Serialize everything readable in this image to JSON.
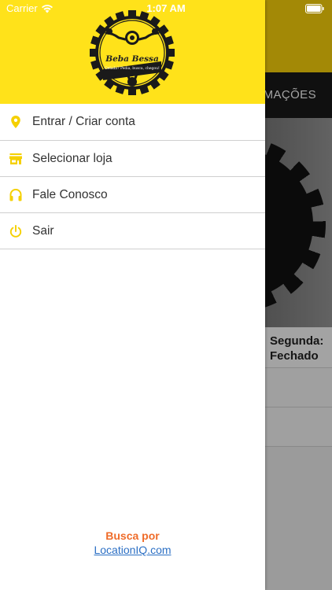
{
  "status_bar": {
    "carrier": "Carrier",
    "time": "1:07 AM"
  },
  "background": {
    "tab_label": "RMAÇÕES",
    "hours_line1": "Segunda:",
    "hours_line2": "Fechado"
  },
  "drawer": {
    "logo": {
      "name": "Beba Bessa",
      "tagline": "Gelada? Pedia, busca, chegou!"
    },
    "menu": [
      {
        "label": "Entrar / Criar conta",
        "icon": "location-pin-icon"
      },
      {
        "label": "Selecionar loja",
        "icon": "store-icon"
      },
      {
        "label": "Fale Conosco",
        "icon": "headphones-icon"
      },
      {
        "label": "Sair",
        "icon": "power-icon"
      }
    ],
    "footer": {
      "powered_by": "Busca por",
      "link": "LocationIQ.com"
    }
  },
  "colors": {
    "accent": "#ffe21a",
    "icon": "#f5d000",
    "powered_by": "#ef6c2a",
    "link": "#2b6fc4"
  }
}
